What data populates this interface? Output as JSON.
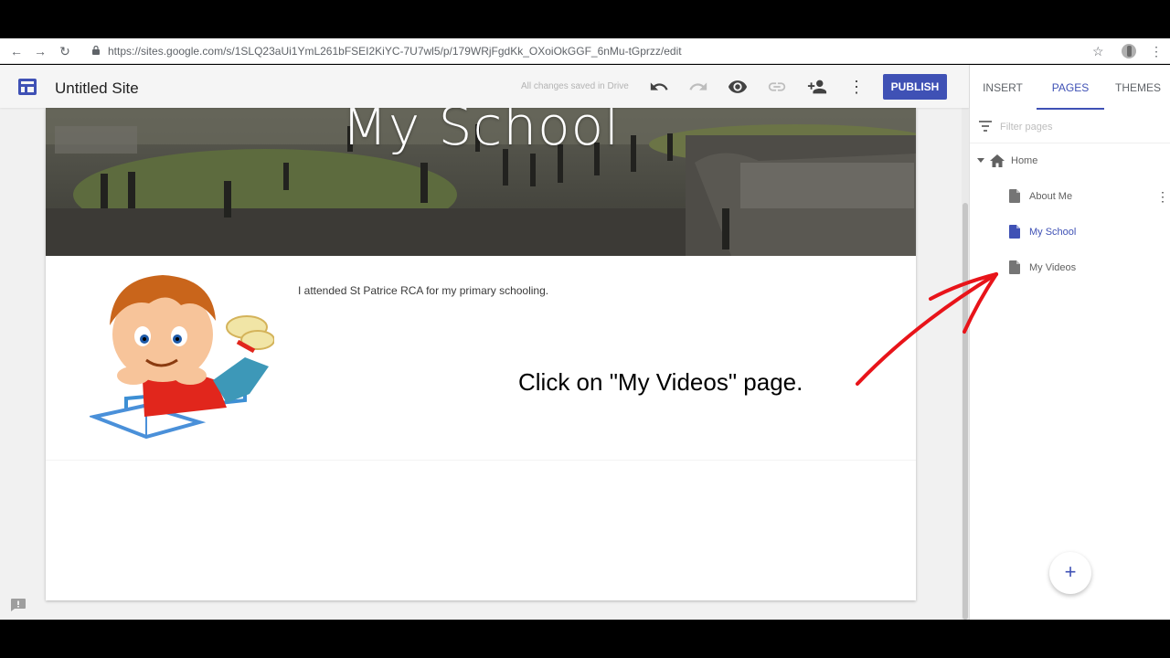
{
  "browser": {
    "url": "https://sites.google.com/s/1SLQ23aUi1YmL261bFSEI2KiYC-7U7wl5/p/179WRjFgdKk_OXoiOkGGF_6nMu-tGprzz/edit",
    "icons": [
      "back-arrow-icon",
      "forward-arrow-icon",
      "reload-icon",
      "lock-icon",
      "star-icon",
      "profile-avatar",
      "browser-menu-icon"
    ]
  },
  "header": {
    "site_title": "Untitled Site",
    "saved_status": "All changes saved in Drive",
    "publish_label": "PUBLISH",
    "icons": [
      "undo-icon",
      "redo-icon",
      "preview-eye-icon",
      "link-icon",
      "share-add-person-icon",
      "more-vert-icon"
    ]
  },
  "page": {
    "banner_title": "My School",
    "body_text": "I attended St Patrice RCA for my primary schooling."
  },
  "annotation": {
    "instruction": "Click on \"My Videos\" page."
  },
  "panel": {
    "tabs": [
      {
        "label": "INSERT",
        "active": false
      },
      {
        "label": "PAGES",
        "active": true
      },
      {
        "label": "THEMES",
        "active": false
      }
    ],
    "filter_placeholder": "Filter pages",
    "tree": {
      "home": "Home",
      "children": [
        {
          "label": "About Me",
          "active": false
        },
        {
          "label": "My School",
          "active": true
        },
        {
          "label": "My Videos",
          "active": false
        }
      ]
    },
    "fab_label": "+"
  },
  "colors": {
    "accent": "#3f51b5",
    "arrow": "#e8141a",
    "canvas": "#f1f1f1"
  }
}
